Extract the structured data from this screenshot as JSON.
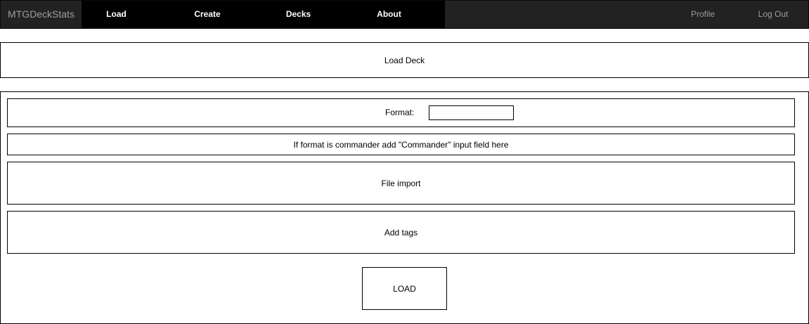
{
  "navbar": {
    "brand": "MTGDeckStats",
    "items": [
      {
        "label": "Load"
      },
      {
        "label": "Create"
      },
      {
        "label": "Decks"
      },
      {
        "label": "About"
      }
    ],
    "right": [
      {
        "label": "Profile"
      },
      {
        "label": "Log Out"
      }
    ]
  },
  "header": {
    "title": "Load Deck"
  },
  "form": {
    "format_label": "Format:",
    "format_value": "",
    "commander_note": "If format is commander add \"Commander\" input field here",
    "file_import_label": "File import",
    "add_tags_label": "Add tags",
    "load_button": "LOAD"
  },
  "colors": {
    "navbar_bg": "#222222",
    "nav_item_bg": "#000000",
    "nav_item_text": "#ffffff",
    "nav_muted_text": "#9d9d9d"
  }
}
